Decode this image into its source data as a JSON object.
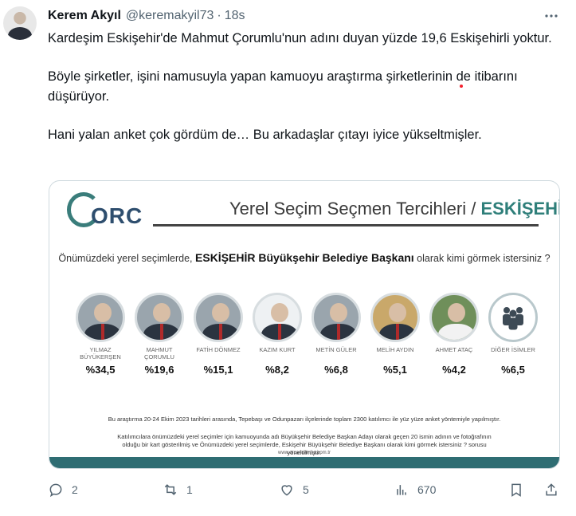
{
  "author": {
    "name": "Kerem Akyıl",
    "handle": "@keremakyil73",
    "separator": "·",
    "time": "18s"
  },
  "tweet": {
    "paragraphs": [
      "Kardeşim Eskişehir'de Mahmut Çorumlu'nun adını duyan yüzde 19,6 Eskişehirli yoktur.",
      "Böyle şirketler, işini namusuyla yapan kamuoyu araştırma şirketlerinin de itibarını düşürüyor.",
      "Hani yalan anket çok gördüm de… Bu arkadaşlar çıtayı iyice yükseltmişler."
    ]
  },
  "poll_image": {
    "logo_text": "ORC",
    "title_prefix": "Yerel Seçim Seçmen Tercihleri / ",
    "title_highlight": "ESKİŞEHİR",
    "question_prefix": "Önümüzdeki yerel seçimlerde, ",
    "question_bold": "ESKİŞEHİR Büyükşehir Belediye Başkanı",
    "question_suffix": " olarak kimi görmek istersiniz ?",
    "candidates": [
      {
        "name": "YILMAZ BÜYÜKERŞEN",
        "pct": "%34,5"
      },
      {
        "name": "MAHMUT ÇORUMLU",
        "pct": "%19,6"
      },
      {
        "name": "FATİH DÖNMEZ",
        "pct": "%15,1"
      },
      {
        "name": "KAZIM KURT",
        "pct": "%8,2"
      },
      {
        "name": "METİN GÜLER",
        "pct": "%6,8"
      },
      {
        "name": "MELİH AYDIN",
        "pct": "%5,1"
      },
      {
        "name": "AHMET ATAÇ",
        "pct": "%4,2"
      },
      {
        "name": "DİĞER İSİMLER",
        "pct": "%6,5"
      }
    ],
    "note1": "Bu araştırma 20-24 Ekim 2023 tarihleri arasında, Tepebaşı ve Odunpazarı ilçelerinde toplam 2300 katılımcı ile yüz yüze anket yöntemiyle yapılmıştır.",
    "note2": "Katılımcılara önümüzdeki yerel seçimler için kamuoyunda adı Büyükşehir Belediye Başkan Adayı olarak geçen 20 ismin adının ve fotoğrafının olduğu bir kart gösterilmiş ve Önümüzdeki yerel seçimlerde, Eskişehir Büyükşehir Belediye Başkanı olarak kimi görmek istersiniz ? sorusu yöneltilmiştir.",
    "url": "www.orcarastirma.com.tr"
  },
  "actions": {
    "replies": "2",
    "reposts": "1",
    "likes": "5",
    "views": "670"
  },
  "colors": {
    "accent": "#2f7f7a",
    "icon": "#536471"
  }
}
